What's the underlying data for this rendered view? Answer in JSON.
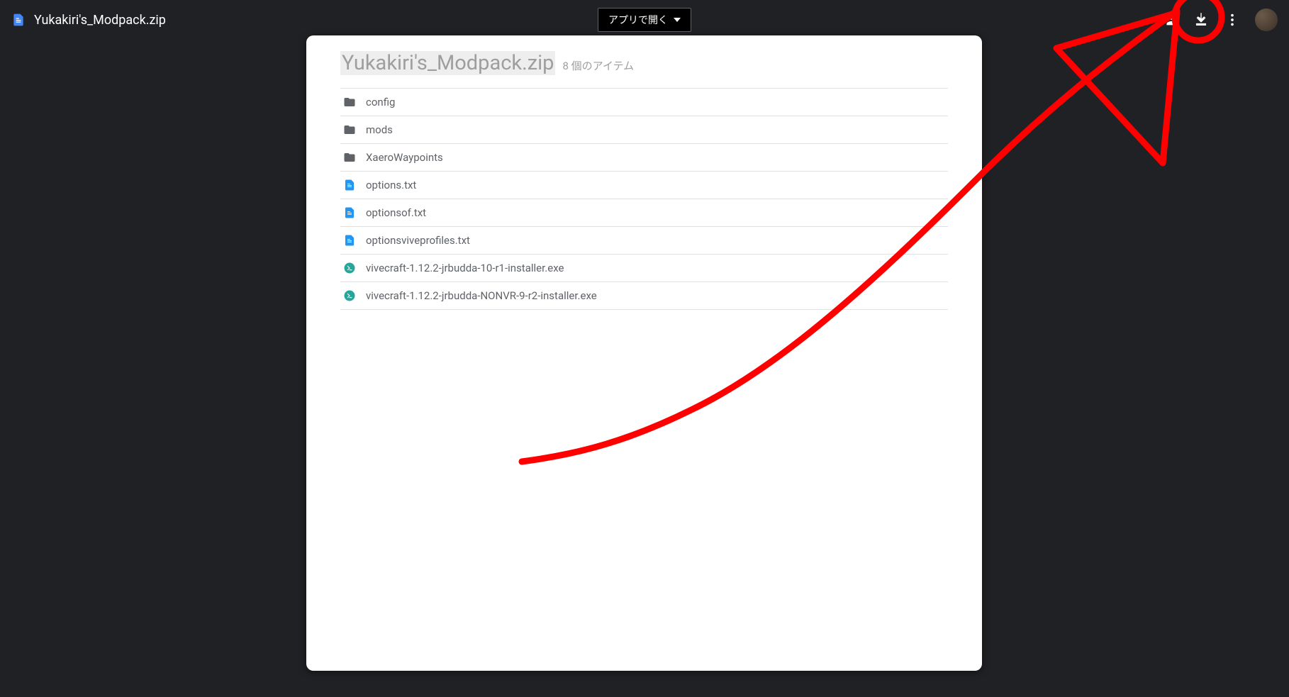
{
  "header": {
    "file_title": "Yukakiri's_Modpack.zip",
    "open_with_label": "アプリで開く"
  },
  "content": {
    "archive_name": "Yukakiri's_Modpack.zip",
    "item_count_label": "8 個のアイテム",
    "items": [
      {
        "name": "config",
        "type": "folder"
      },
      {
        "name": "mods",
        "type": "folder"
      },
      {
        "name": "XaeroWaypoints",
        "type": "folder"
      },
      {
        "name": "options.txt",
        "type": "doc"
      },
      {
        "name": "optionsof.txt",
        "type": "doc"
      },
      {
        "name": "optionsviveprofiles.txt",
        "type": "doc"
      },
      {
        "name": "vivecraft-1.12.2-jrbudda-10-r1-installer.exe",
        "type": "exe"
      },
      {
        "name": "vivecraft-1.12.2-jrbudda-NONVR-9-r2-installer.exe",
        "type": "exe"
      }
    ]
  }
}
